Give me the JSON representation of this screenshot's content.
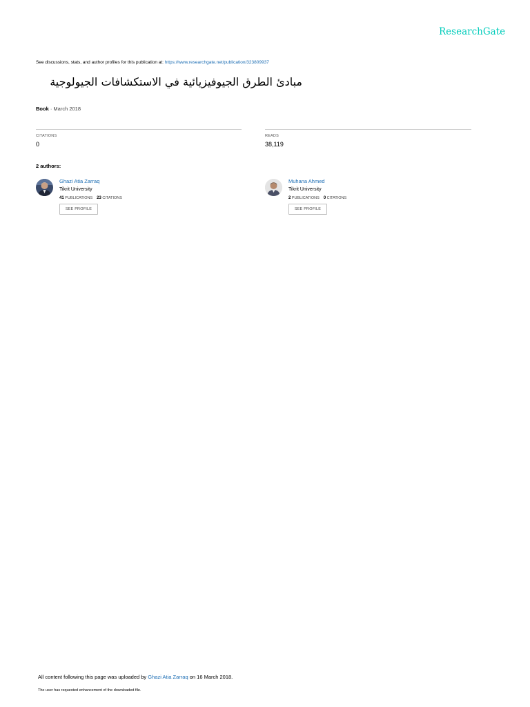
{
  "header": {
    "logo_text": "ResearchGate",
    "logo_color": "#00ccbb"
  },
  "discussion": {
    "prefix": "See discussions, stats, and author profiles for this publication at: ",
    "url": "https://www.researchgate.net/publication/323809937"
  },
  "publication": {
    "title": "مبادئ الطرق الجيوفيزيائية في الاستكشافات الجيولوجية",
    "type": "Book",
    "date": " · March 2018"
  },
  "stats": {
    "citations_label": "CITATIONS",
    "citations_value": "0",
    "reads_label": "READS",
    "reads_value": "38,119"
  },
  "authors_label": "2 authors:",
  "authors": [
    {
      "name": "Ghazi Atia Zarraq",
      "institution": "Tikrit University",
      "publications_count": "41",
      "publications_label": " PUBLICATIONS",
      "citations_count": "23",
      "citations_label": " CITATIONS",
      "button_label": "SEE PROFILE"
    },
    {
      "name": "Muhana Ahmed",
      "institution": "Tikrit University",
      "publications_count": "2",
      "publications_label": " PUBLICATIONS",
      "citations_count": "0",
      "citations_label": " CITATIONS",
      "button_label": "SEE PROFILE"
    }
  ],
  "footer": {
    "upload_prefix": "All content following this page was uploaded by ",
    "uploader": "Ghazi Atia Zarraq",
    "upload_suffix": " on 16 March 2018.",
    "note": "The user has requested enhancement of the downloaded file."
  },
  "colors": {
    "link": "#1a6cb3",
    "divider": "#cfcfcf"
  }
}
